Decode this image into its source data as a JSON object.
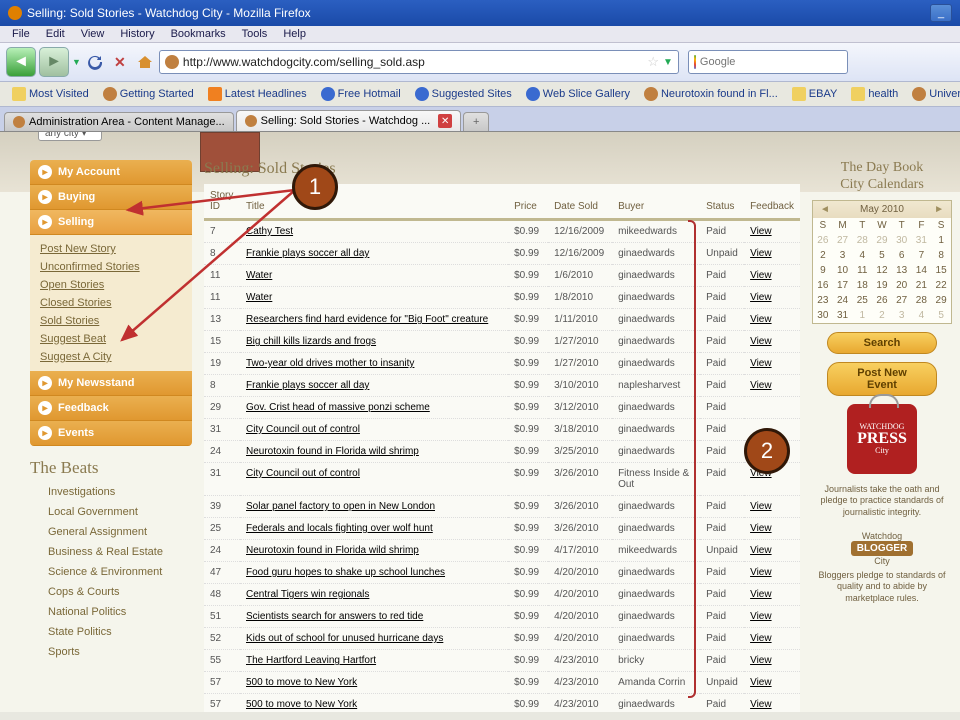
{
  "window": {
    "title": "Selling: Sold Stories - Watchdog City - Mozilla Firefox"
  },
  "menubar": [
    "File",
    "Edit",
    "View",
    "History",
    "Bookmarks",
    "Tools",
    "Help"
  ],
  "url": "http://www.watchdogcity.com/selling_sold.asp",
  "searchbox": {
    "placeholder": "Google"
  },
  "bookmarks": [
    {
      "label": "Most Visited",
      "icon": "folder"
    },
    {
      "label": "Getting Started",
      "icon": "wd"
    },
    {
      "label": "Latest Headlines",
      "icon": "rss"
    },
    {
      "label": "Free Hotmail",
      "icon": "ie"
    },
    {
      "label": "Suggested Sites",
      "icon": "ie"
    },
    {
      "label": "Web Slice Gallery",
      "icon": "ie"
    },
    {
      "label": "Neurotoxin found in Fl...",
      "icon": "wd"
    },
    {
      "label": "EBAY",
      "icon": "folder"
    },
    {
      "label": "health",
      "icon": "folder"
    },
    {
      "label": "Universal Terms of",
      "icon": "wd"
    }
  ],
  "tabs": {
    "inactive": "Administration Area - Content Manage...",
    "active": "Selling: Sold Stories - Watchdog ..."
  },
  "dropdown_fragment": "any city",
  "sidebar": {
    "heads": {
      "my_account": "My Account",
      "buying": "Buying",
      "selling": "Selling",
      "my_newsstand": "My Newsstand",
      "feedback": "Feedback",
      "events": "Events"
    },
    "selling_sub": [
      "Post New Story",
      "Unconfirmed Stories",
      "Open Stories",
      "Closed Stories",
      "Sold Stories",
      "Suggest Beat",
      "Suggest A City"
    ]
  },
  "beats": {
    "header": "The Beats",
    "items": [
      "Investigations",
      "Local Government",
      "General Assignment",
      "Business & Real Estate",
      "Science & Environment",
      "Cops & Courts",
      "National Politics",
      "State Politics",
      "Sports"
    ]
  },
  "page": {
    "title": "Selling: Sold Stories",
    "columns": {
      "id": "Story ID",
      "title": "Title",
      "price": "Price",
      "date": "Date Sold",
      "buyer": "Buyer",
      "status": "Status",
      "feedback": "Feedback"
    },
    "view_label": "View",
    "rows": [
      {
        "id": "7",
        "title": "Cathy Test",
        "price": "$0.99",
        "date": "12/16/2009",
        "buyer": "mikeedwards",
        "status": "Paid"
      },
      {
        "id": "8",
        "title": "Frankie plays soccer all day",
        "price": "$0.99",
        "date": "12/16/2009",
        "buyer": "ginaedwards",
        "status": "Unpaid"
      },
      {
        "id": "11",
        "title": "Water",
        "price": "$0.99",
        "date": "1/6/2010",
        "buyer": "ginaedwards",
        "status": "Paid"
      },
      {
        "id": "11",
        "title": "Water",
        "price": "$0.99",
        "date": "1/8/2010",
        "buyer": "ginaedwards",
        "status": "Paid"
      },
      {
        "id": "13",
        "title": "Researchers find hard evidence for \"Big Foot\" creature",
        "price": "$0.99",
        "date": "1/11/2010",
        "buyer": "ginaedwards",
        "status": "Paid"
      },
      {
        "id": "15",
        "title": "Big chill kills lizards and frogs",
        "price": "$0.99",
        "date": "1/27/2010",
        "buyer": "ginaedwards",
        "status": "Paid"
      },
      {
        "id": "19",
        "title": "Two-year old drives mother to insanity",
        "price": "$0.99",
        "date": "1/27/2010",
        "buyer": "ginaedwards",
        "status": "Paid"
      },
      {
        "id": "8",
        "title": "Frankie plays soccer all day",
        "price": "$0.99",
        "date": "3/10/2010",
        "buyer": "naplesharvest",
        "status": "Paid"
      },
      {
        "id": "29",
        "title": "Gov. Crist head of massive ponzi scheme",
        "price": "$0.99",
        "date": "3/12/2010",
        "buyer": "ginaedwards",
        "status": "Paid"
      },
      {
        "id": "31",
        "title": "City Council out of control",
        "price": "$0.99",
        "date": "3/18/2010",
        "buyer": "ginaedwards",
        "status": "Paid"
      },
      {
        "id": "24",
        "title": "Neurotoxin found in Florida wild shrimp",
        "price": "$0.99",
        "date": "3/25/2010",
        "buyer": "ginaedwards",
        "status": "Paid"
      },
      {
        "id": "31",
        "title": "City Council out of control",
        "price": "$0.99",
        "date": "3/26/2010",
        "buyer": "Fitness Inside & Out",
        "status": "Paid"
      },
      {
        "id": "39",
        "title": "Solar panel factory to open in New London",
        "price": "$0.99",
        "date": "3/26/2010",
        "buyer": "ginaedwards",
        "status": "Paid"
      },
      {
        "id": "25",
        "title": "Federals and locals fighting over wolf hunt",
        "price": "$0.99",
        "date": "3/26/2010",
        "buyer": "ginaedwards",
        "status": "Paid"
      },
      {
        "id": "24",
        "title": "Neurotoxin found in Florida wild shrimp",
        "price": "$0.99",
        "date": "4/17/2010",
        "buyer": "mikeedwards",
        "status": "Unpaid"
      },
      {
        "id": "47",
        "title": "Food guru hopes to shake up school lunches",
        "price": "$0.99",
        "date": "4/20/2010",
        "buyer": "ginaedwards",
        "status": "Paid"
      },
      {
        "id": "48",
        "title": "Central Tigers win regionals",
        "price": "$0.99",
        "date": "4/20/2010",
        "buyer": "ginaedwards",
        "status": "Paid"
      },
      {
        "id": "51",
        "title": "Scientists search for answers to red tide",
        "price": "$0.99",
        "date": "4/20/2010",
        "buyer": "ginaedwards",
        "status": "Paid"
      },
      {
        "id": "52",
        "title": "Kids out of school for unused hurricane days",
        "price": "$0.99",
        "date": "4/20/2010",
        "buyer": "ginaedwards",
        "status": "Paid"
      },
      {
        "id": "55",
        "title": "The Hartford Leaving Hartfort",
        "price": "$0.99",
        "date": "4/23/2010",
        "buyer": "bricky",
        "status": "Paid"
      },
      {
        "id": "57",
        "title": "500 to move to New York",
        "price": "$0.99",
        "date": "4/23/2010",
        "buyer": "Amanda Corrin",
        "status": "Unpaid"
      },
      {
        "id": "57",
        "title": "500 to move to New York",
        "price": "$0.99",
        "date": "4/23/2010",
        "buyer": "ginaedwards",
        "status": "Paid"
      }
    ]
  },
  "right": {
    "daybook1": "The Day Book",
    "daybook2": "City Calendars",
    "cal_month": "May 2010",
    "cal_days": [
      "S",
      "M",
      "T",
      "W",
      "T",
      "F",
      "S"
    ],
    "cal_grid": [
      [
        "26",
        "27",
        "28",
        "29",
        "30",
        "31",
        "1"
      ],
      [
        "2",
        "3",
        "4",
        "5",
        "6",
        "7",
        "8"
      ],
      [
        "9",
        "10",
        "11",
        "12",
        "13",
        "14",
        "15"
      ],
      [
        "16",
        "17",
        "18",
        "19",
        "20",
        "21",
        "22"
      ],
      [
        "23",
        "24",
        "25",
        "26",
        "27",
        "28",
        "29"
      ],
      [
        "30",
        "31",
        "1",
        "2",
        "3",
        "4",
        "5"
      ]
    ],
    "search_btn": "Search",
    "post_btn": "Post New Event",
    "press_top": "WATCHDOG",
    "press_mid": "PRESS",
    "press_bot": "City",
    "press_blurb": "Journalists take the oath and pledge to practice standards of journalistic integrity.",
    "blogger_top": "Watchdog",
    "blogger_mid": "BLOGGER",
    "blogger_bot": "City",
    "blogger_blurb": "Bloggers pledge to standards of quality and to abide by marketplace rules."
  },
  "callouts": {
    "one": "1",
    "two": "2"
  }
}
